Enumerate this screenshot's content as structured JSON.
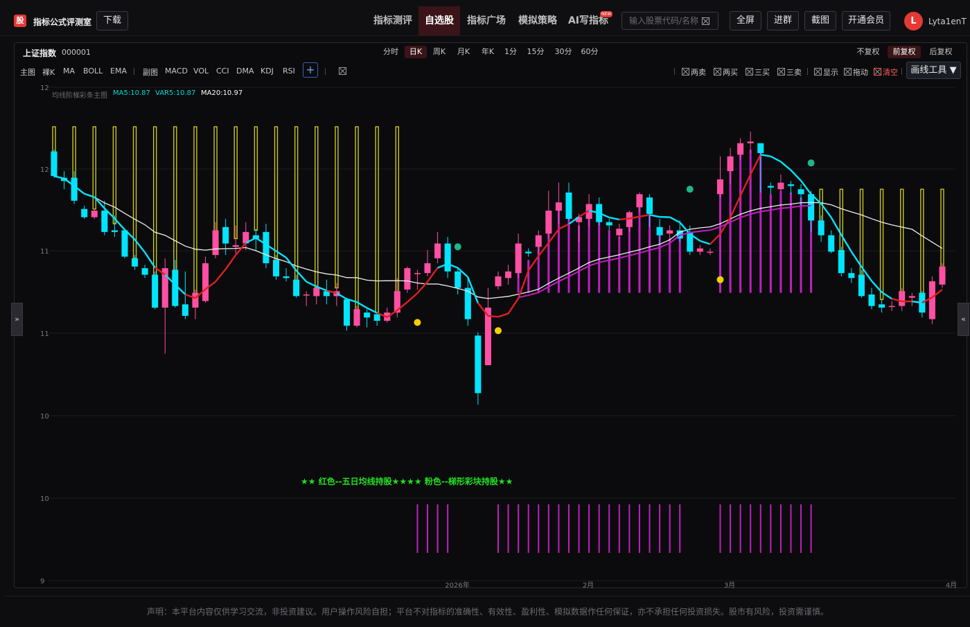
{
  "header": {
    "logo_text": "股",
    "brand": "指标公式评测室",
    "download": "下载",
    "nav": [
      "指标测评",
      "自选股",
      "指标广场",
      "模拟策略",
      "AI写指标"
    ],
    "new_badge": "NEW",
    "search_placeholder": "输入股票代码/名称",
    "buttons": [
      "全屏",
      "进群",
      "截图",
      "开通会员"
    ],
    "avatar_letter": "L",
    "username": "Lyta1enT"
  },
  "panel": {
    "stock_name": "上证指数",
    "stock_code": "000001",
    "periods": [
      "分时",
      "日K",
      "周K",
      "月K",
      "年K",
      "1分",
      "15分",
      "30分",
      "60分"
    ],
    "adjust": [
      "不复权",
      "前复权",
      "后复权"
    ],
    "main_indicators": [
      "主图",
      "裸K",
      "MA",
      "BOLL",
      "EMA"
    ],
    "sub_indicators": [
      "副图",
      "MACD",
      "VOL",
      "CCI",
      "DMA",
      "KDJ",
      "RSI"
    ],
    "add_symbol": "+",
    "signal_toggles": [
      "两卖",
      "两买",
      "三买",
      "三卖",
      "显示",
      "拖动",
      "清空"
    ],
    "draw_tool": "画线工具",
    "draw_tool_arrow": "▼",
    "left_handle": "»",
    "right_handle": "«"
  },
  "chart_data": {
    "type": "candlestick",
    "indicator_title": "均线阶梯彩条主图",
    "legend": [
      {
        "label": "MA5:10.87",
        "color": "#00d9d9"
      },
      {
        "label": "VAR5:10.87",
        "color": "#00d9d9"
      },
      {
        "label": "MA20:10.97",
        "color": "#ffffff"
      }
    ],
    "annotation": "★★ 红色--五日均线持股★★★★ 粉色--梯形彩块持股★★",
    "y_ticks": [
      "12",
      "12",
      "11",
      "11",
      "10",
      "10",
      "9"
    ],
    "x_ticks": [
      "2026年",
      "2月",
      "3月",
      "4月"
    ],
    "colors": {
      "up": "#ff4fa3",
      "down": "#00e5ff",
      "ma5": "#00e5ff",
      "ma5_hold": "#e01f1f",
      "ma20": "#f0f0f0",
      "ladder": "#c8c820",
      "ladder_pink": "#c01fc0",
      "signal_yellow": "#f2d000",
      "signal_green": "#1fb58a"
    },
    "candles": [
      [
        11.81,
        11.66,
        11.65,
        11.82
      ],
      [
        11.65,
        11.63,
        11.58,
        11.69
      ],
      [
        11.65,
        11.51,
        11.49,
        11.69
      ],
      [
        11.46,
        11.41,
        11.4,
        11.48
      ],
      [
        11.41,
        11.45,
        11.4,
        11.46
      ],
      [
        11.45,
        11.32,
        11.3,
        11.51
      ],
      [
        11.33,
        11.32,
        11.29,
        11.42
      ],
      [
        11.33,
        11.17,
        11.16,
        11.34
      ],
      [
        11.16,
        11.11,
        11.09,
        11.18
      ],
      [
        11.1,
        11.06,
        11.04,
        11.12
      ],
      [
        11.06,
        10.86,
        10.85,
        11.08
      ],
      [
        10.86,
        11.1,
        10.58,
        11.16
      ],
      [
        11.09,
        10.87,
        10.86,
        11.15
      ],
      [
        10.88,
        10.81,
        10.79,
        11.08
      ],
      [
        10.86,
        10.95,
        10.79,
        10.97
      ],
      [
        10.9,
        11.13,
        10.89,
        11.17
      ],
      [
        11.18,
        11.33,
        11.16,
        11.38
      ],
      [
        11.35,
        11.25,
        11.18,
        11.4
      ],
      [
        11.23,
        11.24,
        11.19,
        11.36
      ],
      [
        11.25,
        11.32,
        11.21,
        11.38
      ],
      [
        11.3,
        11.28,
        11.21,
        11.34
      ],
      [
        11.32,
        11.13,
        11.1,
        11.37
      ],
      [
        11.15,
        11.05,
        11.03,
        11.18
      ],
      [
        11.05,
        11.04,
        11.02,
        11.1
      ],
      [
        11.03,
        10.93,
        10.92,
        11.06
      ],
      [
        10.94,
        10.94,
        10.87,
        10.96
      ],
      [
        10.93,
        10.98,
        10.88,
        11.0
      ],
      [
        10.96,
        10.93,
        10.88,
        11.03
      ],
      [
        10.93,
        10.96,
        10.87,
        11.01
      ],
      [
        10.91,
        10.75,
        10.72,
        10.92
      ],
      [
        10.75,
        10.85,
        10.74,
        10.87
      ],
      [
        10.83,
        10.8,
        10.74,
        10.85
      ],
      [
        10.82,
        10.78,
        10.75,
        10.83
      ],
      [
        10.78,
        10.83,
        10.77,
        10.86
      ],
      [
        10.83,
        10.96,
        10.8,
        11.04
      ],
      [
        10.97,
        11.1,
        10.95,
        11.11
      ],
      [
        11.07,
        11.07,
        10.97,
        11.09
      ],
      [
        11.07,
        11.13,
        11.05,
        11.21
      ],
      [
        11.16,
        11.25,
        11.13,
        11.32
      ],
      [
        11.25,
        11.08,
        11.04,
        11.29
      ],
      [
        11.08,
        10.98,
        10.94,
        11.1
      ],
      [
        10.98,
        10.79,
        10.75,
        11.04
      ],
      [
        10.69,
        10.34,
        10.27,
        10.71
      ],
      [
        10.51,
        10.86,
        10.51,
        10.98
      ],
      [
        10.99,
        11.05,
        10.97,
        11.08
      ],
      [
        11.04,
        11.08,
        11.0,
        11.12
      ],
      [
        11.07,
        11.25,
        11.04,
        11.31
      ],
      [
        11.2,
        11.19,
        11.17,
        11.22
      ],
      [
        11.23,
        11.3,
        11.19,
        11.33
      ],
      [
        11.31,
        11.45,
        11.28,
        11.57
      ],
      [
        11.45,
        11.5,
        11.37,
        11.62
      ],
      [
        11.56,
        11.4,
        11.39,
        11.62
      ],
      [
        11.38,
        11.41,
        11.26,
        11.43
      ],
      [
        11.4,
        11.49,
        11.35,
        11.55
      ],
      [
        11.49,
        11.38,
        11.36,
        11.53
      ],
      [
        11.38,
        11.36,
        11.33,
        11.4
      ],
      [
        11.3,
        11.34,
        11.28,
        11.37
      ],
      [
        11.35,
        11.44,
        11.32,
        11.45
      ],
      [
        11.47,
        11.55,
        11.44,
        11.56
      ],
      [
        11.53,
        11.43,
        11.35,
        11.55
      ],
      [
        11.35,
        11.3,
        11.25,
        11.4
      ],
      [
        11.31,
        11.33,
        11.27,
        11.36
      ],
      [
        11.33,
        11.28,
        11.26,
        11.39
      ],
      [
        11.32,
        11.2,
        11.18,
        11.36
      ],
      [
        11.2,
        11.22,
        11.18,
        11.24
      ],
      [
        11.2,
        11.2,
        11.18,
        11.22
      ],
      [
        11.55,
        11.64,
        11.53,
        11.78
      ],
      [
        11.69,
        11.78,
        11.61,
        11.83
      ],
      [
        11.79,
        11.86,
        11.76,
        11.89
      ],
      [
        11.86,
        11.87,
        11.8,
        11.93
      ],
      [
        11.86,
        11.8,
        11.56,
        11.86
      ],
      [
        11.6,
        11.59,
        11.55,
        11.62
      ],
      [
        11.58,
        11.62,
        11.57,
        11.67
      ],
      [
        11.61,
        11.6,
        11.55,
        11.63
      ],
      [
        11.58,
        11.55,
        11.48,
        11.61
      ],
      [
        11.55,
        11.39,
        11.32,
        11.57
      ],
      [
        11.39,
        11.3,
        11.26,
        11.42
      ],
      [
        11.3,
        11.2,
        11.19,
        11.33
      ],
      [
        11.21,
        11.07,
        11.05,
        11.23
      ],
      [
        11.07,
        11.04,
        11.01,
        11.1
      ],
      [
        11.06,
        10.93,
        10.92,
        11.09
      ],
      [
        10.94,
        10.87,
        10.85,
        10.98
      ],
      [
        10.88,
        10.86,
        10.83,
        10.91
      ],
      [
        10.87,
        10.87,
        10.84,
        10.9
      ],
      [
        10.87,
        10.96,
        10.84,
        10.98
      ],
      [
        10.92,
        10.93,
        10.87,
        10.95
      ],
      [
        10.95,
        10.83,
        10.8,
        10.96
      ],
      [
        10.79,
        11.02,
        10.76,
        11.05
      ],
      [
        11.0,
        11.11,
        10.98,
        11.13
      ]
    ],
    "buy_marks": [
      12.2
    ],
    "signal_points": [
      {
        "index": 36,
        "value": 10.77,
        "color": "yellow"
      },
      {
        "index": 40,
        "value": 11.23,
        "color": "green"
      },
      {
        "index": 44,
        "value": 10.72,
        "color": "yellow"
      },
      {
        "index": 63,
        "value": 11.58,
        "color": "green"
      },
      {
        "index": 66,
        "value": 11.03,
        "color": "yellow"
      },
      {
        "index": 75,
        "value": 11.74,
        "color": "green"
      }
    ],
    "ladder_yellow_ranges": [
      [
        0,
        35
      ],
      [
        76,
        89
      ]
    ],
    "ladder_pink_range": [
      46,
      62
    ],
    "ladder_pink_range2": [
      66,
      75
    ],
    "lower_bars_ranges": [
      [
        36,
        39
      ],
      [
        44,
        62
      ],
      [
        66,
        75
      ]
    ]
  },
  "footer": "声明：本平台内容仅供学习交流，非投资建议。用户操作风险自担；平台不对指标的准确性、有效性、盈利性、模拟数据作任何保证，亦不承担任何投资损失。股市有风险，投资需谨慎。"
}
